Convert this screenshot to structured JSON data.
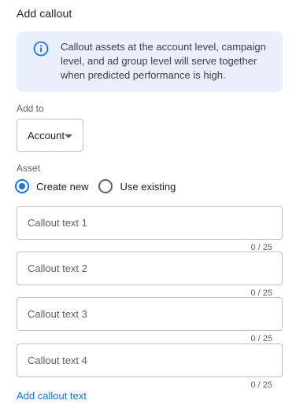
{
  "header": {
    "title": "Add callout"
  },
  "info": {
    "icon": "info-icon",
    "text": "Callout assets at the account level, campaign level, and ad group level will serve together when predicted performance is high."
  },
  "add_to": {
    "label": "Add to",
    "selected": "Account"
  },
  "asset": {
    "label": "Asset",
    "options": [
      {
        "label": "Create new",
        "checked": true
      },
      {
        "label": "Use existing",
        "checked": false
      }
    ]
  },
  "fields": [
    {
      "placeholder": "Callout text 1",
      "counter": "0 / 25"
    },
    {
      "placeholder": "Callout text 2",
      "counter": "0 / 25"
    },
    {
      "placeholder": "Callout text 3",
      "counter": "0 / 25"
    },
    {
      "placeholder": "Callout text 4",
      "counter": "0 / 25"
    }
  ],
  "add_link": "Add callout text",
  "colors": {
    "accent": "#1a73e8",
    "info_bg": "#e8f0fe",
    "border": "#bdc1c6",
    "muted_text": "#5f6368"
  }
}
